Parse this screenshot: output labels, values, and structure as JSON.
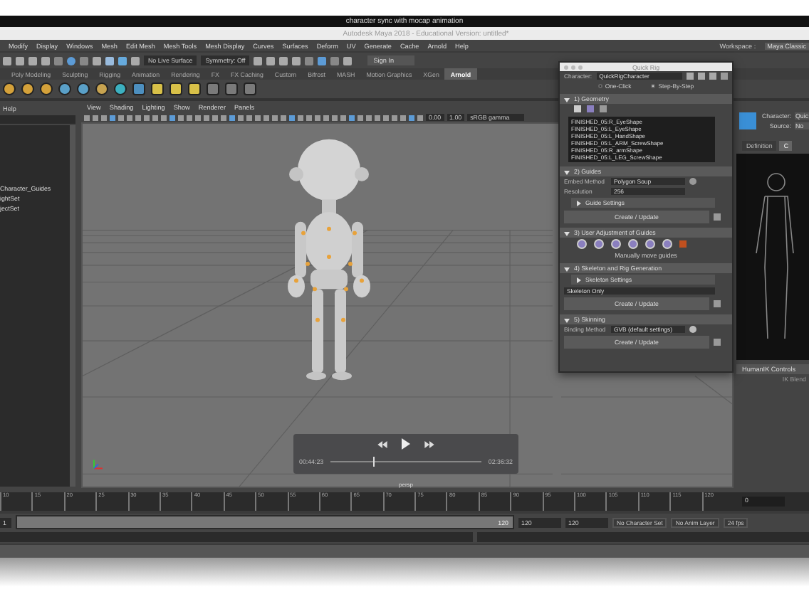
{
  "os_title": "character sync with mocap animation",
  "app_title": "Autodesk Maya 2018 - Educational Version: untitled*",
  "menu": [
    "Modify",
    "Display",
    "Windows",
    "Mesh",
    "Edit Mesh",
    "Mesh Tools",
    "Mesh Display",
    "Curves",
    "Surfaces",
    "Deform",
    "UV",
    "Generate",
    "Cache",
    "Arnold",
    "Help"
  ],
  "workspace": {
    "label": "Workspace :",
    "value": "Maya Classic"
  },
  "toolbar": {
    "live_surface": "No Live Surface",
    "symmetry": "Symmetry: Off",
    "sign_in": "Sign In"
  },
  "shelf_tabs": [
    {
      "label": "Poly Modeling",
      "selected": false
    },
    {
      "label": "Sculpting",
      "selected": false
    },
    {
      "label": "Rigging",
      "selected": false
    },
    {
      "label": "Animation",
      "selected": false
    },
    {
      "label": "Rendering",
      "selected": false
    },
    {
      "label": "FX",
      "selected": false
    },
    {
      "label": "FX Caching",
      "selected": false
    },
    {
      "label": "Custom",
      "selected": false
    },
    {
      "label": "Bifrost",
      "selected": false
    },
    {
      "label": "MASH",
      "selected": false
    },
    {
      "label": "Motion Graphics",
      "selected": false
    },
    {
      "label": "XGen",
      "selected": false
    },
    {
      "label": "Arnold",
      "selected": true
    }
  ],
  "outliner": {
    "menu": "Help",
    "items": [
      "Character_Guides",
      "ightSet",
      "jectSet"
    ]
  },
  "viewport": {
    "menu": [
      "View",
      "Shading",
      "Lighting",
      "Show",
      "Renderer",
      "Panels"
    ],
    "exposure": "0.00",
    "gamma": "1.00",
    "color_space": "sRGB gamma",
    "camera": "persp"
  },
  "player": {
    "elapsed": "00:44:23",
    "total": "02:36:32",
    "level": 0.28
  },
  "quick_rig": {
    "title": "Quick Rig",
    "character_label": "Character:",
    "character": "QuickRigCharacter",
    "modes": [
      {
        "label": "One-Click",
        "selected": false
      },
      {
        "label": "Step-By-Step",
        "selected": true
      }
    ],
    "geometry": {
      "title": "1) Geometry",
      "expanded": true,
      "items": [
        "FINISHED_05:R_EyeShape",
        "FINISHED_05:L_EyeShape",
        "FINISHED_05:L_HandShape",
        "FINISHED_05:L_ARM_ScrewShape",
        "FINISHED_05:R_armShape",
        "FINISHED_05:L_LEG_ScrewShape"
      ]
    },
    "guides": {
      "title": "2) Guides",
      "expanded": true,
      "embed_label": "Embed Method",
      "embed": "Polygon Soup",
      "resolution_label": "Resolution",
      "resolution": "256",
      "settings": {
        "label": "Guide Settings",
        "expanded": false
      },
      "button": "Create / Update"
    },
    "adjust": {
      "title": "3) User Adjustment of Guides",
      "expanded": true,
      "caption": "Manually move guides"
    },
    "skeleton": {
      "title": "4) Skeleton and Rig Generation",
      "expanded": true,
      "settings": {
        "label": "Skeleton Settings",
        "expanded": false
      },
      "option": "Skeleton Only",
      "button": "Create / Update"
    },
    "skinning": {
      "title": "5) Skinning",
      "expanded": true,
      "binding_label": "Binding Method",
      "binding": "GVB (default settings)",
      "button": "Create / Update"
    }
  },
  "humanik": {
    "character_label": "Character:",
    "character": "Quic",
    "source_label": "Source:",
    "source": "No",
    "tabs": [
      {
        "label": "Definition",
        "selected": false
      },
      {
        "label": "C",
        "selected": true
      }
    ],
    "controls": "HumanIK Controls",
    "blend": "IK Blend"
  },
  "timeline": {
    "ticks": [
      "10",
      "15",
      "20",
      "25",
      "30",
      "35",
      "40",
      "45",
      "50",
      "55",
      "60",
      "65",
      "70",
      "75",
      "80",
      "85",
      "90",
      "95",
      "100",
      "105",
      "110",
      "115",
      "120"
    ],
    "current": "0"
  },
  "range": {
    "level": 1,
    "start": "1",
    "end": "120",
    "anim_end": "120",
    "max": "120",
    "character_set": "No Character Set",
    "anim_layer": "No Anim Layer",
    "fps": "24 fps"
  }
}
